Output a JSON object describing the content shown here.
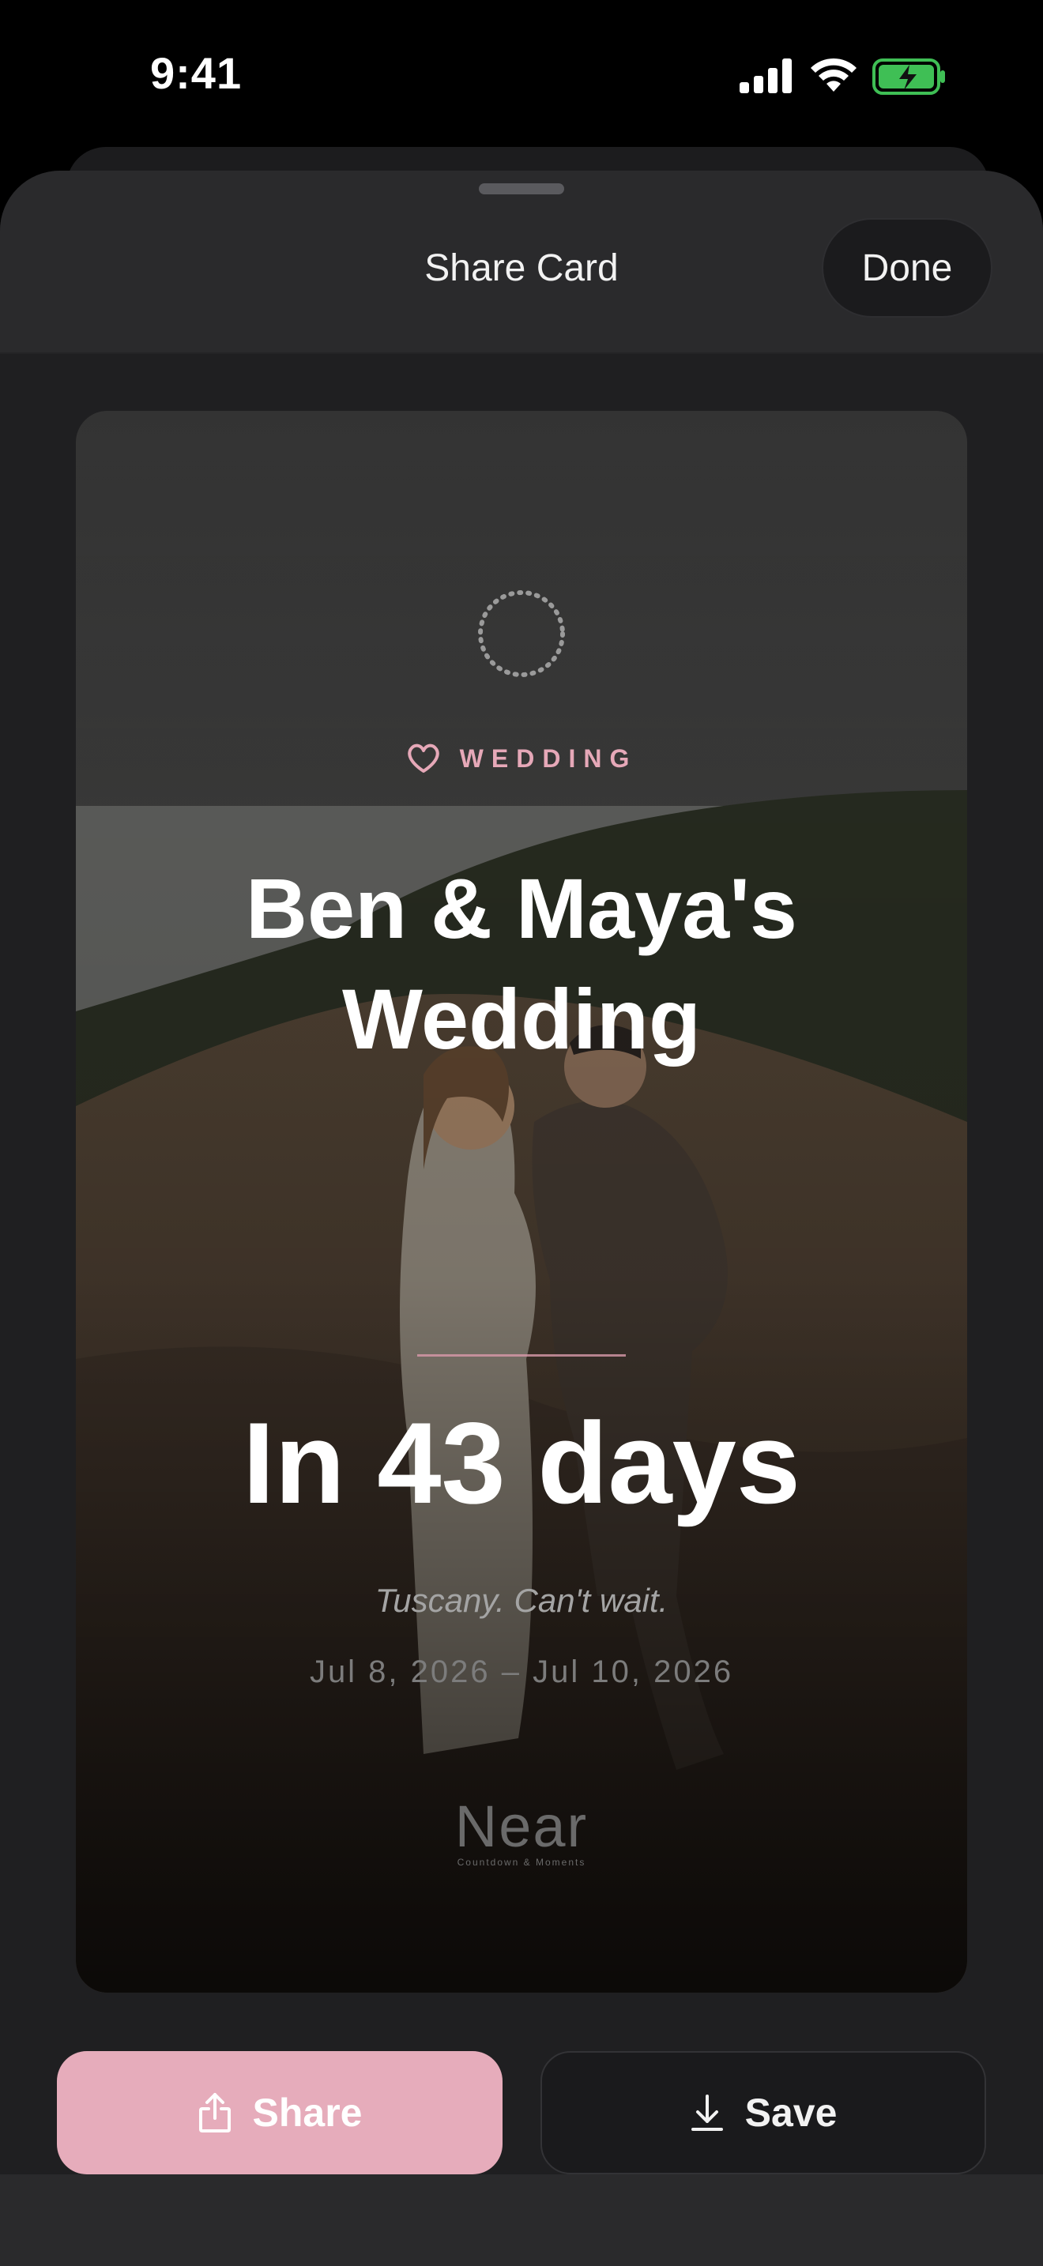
{
  "status_bar": {
    "time": "9:41"
  },
  "nav": {
    "title": "Share Card",
    "done_label": "Done"
  },
  "card": {
    "category": "WEDDING",
    "title_line1": "Ben & Maya's",
    "title_line2": "Wedding",
    "countdown": "In 43 days",
    "note": "Tuscany. Can't wait.",
    "dates": "Jul 8, 2026 – Jul 10, 2026",
    "brand_name": "Near",
    "brand_tagline": "Countdown & Moments"
  },
  "actions": {
    "share_label": "Share",
    "save_label": "Save"
  },
  "colors": {
    "accent": "#e6acbb",
    "tag": "#e6a8b8",
    "sheet": "#1f1f21",
    "nav": "#2a2a2c"
  }
}
